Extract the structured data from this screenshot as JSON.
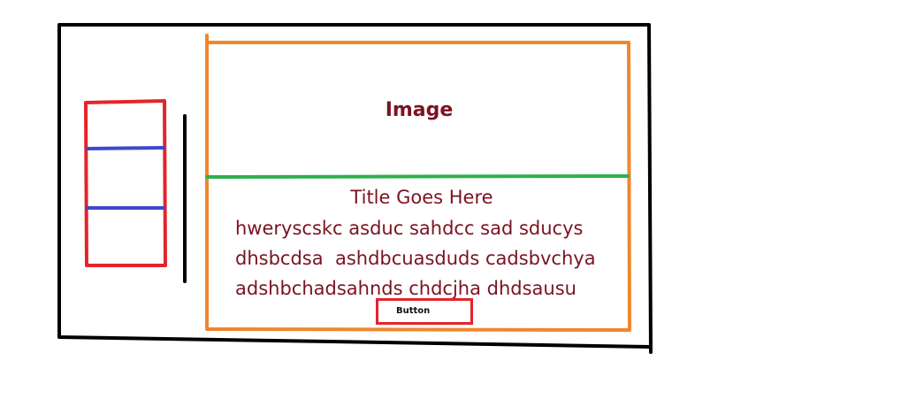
{
  "image_placeholder": {
    "label": "Image"
  },
  "card": {
    "title": "Title Goes Here",
    "body_lines": [
      "hweryscskc asduc sahdcc sad sducys",
      "dhsbcdsa  ashdbcuasduds cadsbvchya",
      "adshbchadsahnds chdcjha dhdsausu"
    ],
    "button_label": "Button"
  },
  "colors": {
    "outer_frame": "#000000",
    "card_outline": "#f0862c",
    "image_divider": "#2eb04b",
    "sidebar_outline": "#e2252b",
    "sidebar_dividers": "#3f48cc",
    "separator": "#000000",
    "text": "#7b1320",
    "button_outline": "#e2252b"
  }
}
